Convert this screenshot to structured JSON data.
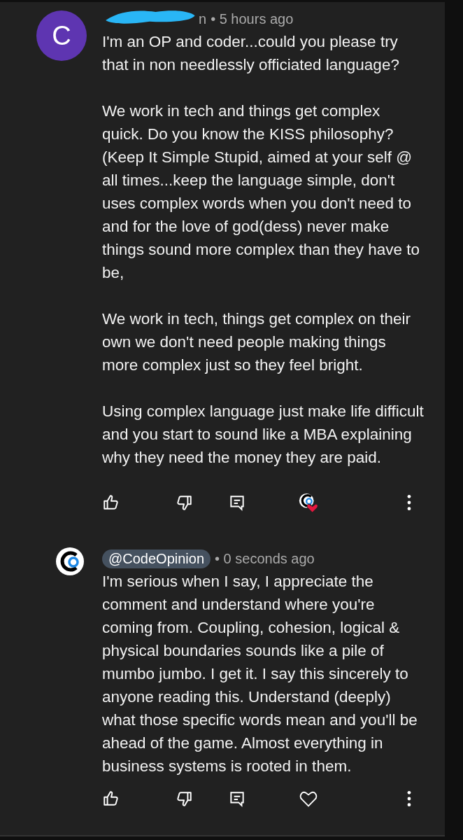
{
  "comments": [
    {
      "avatar": {
        "kind": "letter",
        "letter": "C",
        "color": "#5e35b1"
      },
      "author": "n",
      "author_redacted": true,
      "author_highlighted": false,
      "time": "• 5 hours ago",
      "paragraphs": [
        "I'm an OP and coder...could you please try that in non needlessly officiated language?",
        "We work in tech and things get complex quick. Do you know the KISS philosophy? (Keep It Simple Stupid, aimed at your self @ all times...keep the language simple, don't uses complex words when you don't need to and for the love of god(dess) never make things sound more complex than they have to be,",
        "We work in tech, things get complex on their own we don't need people making things more complex just so they feel bright.",
        "Using complex language just make life difficult and you start to sound like a MBA explaining why they need the money they are paid."
      ],
      "creator_hearted": true,
      "replies": [
        {
          "avatar": {
            "kind": "logo"
          },
          "author": "@CodeOpinion",
          "author_redacted": false,
          "author_highlighted": true,
          "time": "• 0 seconds ago",
          "paragraphs": [
            "I'm serious when I say, I appreciate the comment and understand where you're coming from. Coupling, cohesion, logical & physical boundaries sounds like a pile of mumbo jumbo. I get it. I say this sincerely to anyone reading this. Understand (deeply) what those specific words mean and you'll be ahead of the game. Almost everything in business systems is rooted in them."
          ],
          "creator_hearted": false
        }
      ]
    }
  ]
}
